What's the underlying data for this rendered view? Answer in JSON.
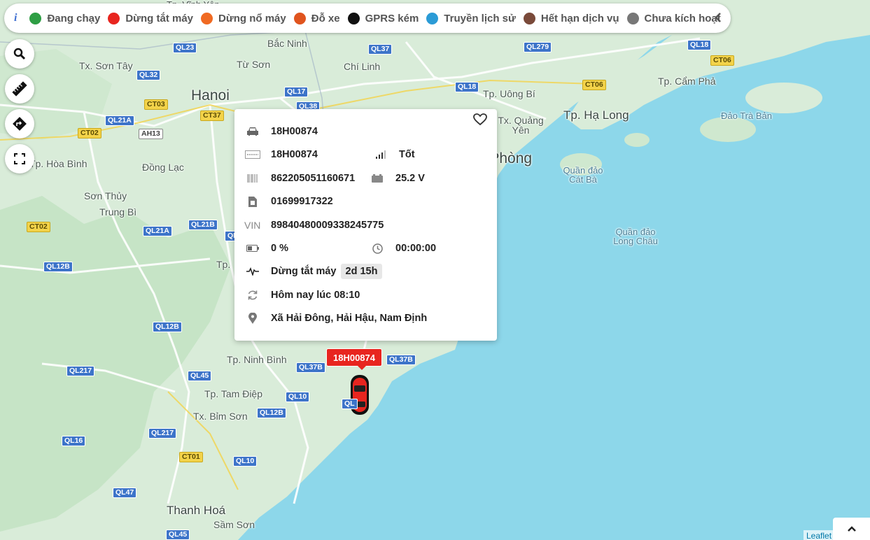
{
  "legend": {
    "info_icon": "i",
    "items": [
      {
        "label": "Đang chạy",
        "color": "#2e9e44"
      },
      {
        "label": "Dừng tắt máy",
        "color": "#e8251f"
      },
      {
        "label": "Dừng nổ máy",
        "color": "#f06a22"
      },
      {
        "label": "Đỗ xe",
        "color": "#e0541e"
      },
      {
        "label": "GPRS kém",
        "color": "#111111"
      },
      {
        "label": "Truyền lịch sử",
        "color": "#2b9bd6"
      },
      {
        "label": "Hết hạn dịch vụ",
        "color": "#7a4a3a"
      },
      {
        "label": "Chưa kích hoạt",
        "color": "#777777"
      }
    ],
    "collapse_icon": "chevron-left-icon"
  },
  "controls": [
    "search-icon",
    "ruler-icon",
    "directions-icon",
    "fullscreen-icon"
  ],
  "popup": {
    "plate": "18H00874",
    "license_plate": "18H00874",
    "signal": "Tốt",
    "imei": "862205051160671",
    "voltage": "25.2 V",
    "sim": "01699917322",
    "vin_label": "VIN",
    "vin": "89840480009338245775",
    "battery": "0 %",
    "duration": "00:00:00",
    "status": "Dừng tắt máy",
    "status_duration": "2d 15h",
    "updated": "Hôm nay lúc 08:10",
    "address": "Xã Hải Đông, Hải Hậu, Nam Định"
  },
  "vehicle": {
    "label": "18H00874",
    "color": "#e8251f"
  },
  "map": {
    "places": {
      "vinh_yen": "Tp. Vĩnh Yên",
      "bac_ninh": "Bắc Ninh",
      "tx_son_tay": "Tx. Sơn Tây",
      "tu_son": "Từ Sơn",
      "chi_linh": "Chí Linh",
      "hanoi": "Hanoi",
      "uong_bi": "Tp. Uông Bí",
      "cam_pha": "Tp. Cẩm Phả",
      "ha_long": "Tp. Hạ Long",
      "tx_quang_yen": "Tx. Quảng Yên",
      "dao_tra_ban": "Đảo Trà Bản",
      "hoa_binh": "Tp. Hòa Bình",
      "dong_lac": "Đồng Lạc",
      "hai_phong": "Hải Phòng",
      "quan_dao_cat_ba": "Quần đảo Cát Bà",
      "son_thuy": "Sơn Thủy",
      "trung_bi": "Trung Bì",
      "quan_dao_long_chau": "Quần đảo Long Châu",
      "tp_partial": "Tp.",
      "ninh_binh": "Tp. Ninh Bình",
      "tam_diep": "Tp. Tam Điệp",
      "bim_son": "Tx. Bỉm Sơn",
      "thanh_hoa": "Thanh Hoá",
      "sam_son": "Sầm Sơn"
    },
    "roads": {
      "ql23": "QL23",
      "ql37a": "QL37",
      "ql279": "QL279",
      "ql18a": "QL18",
      "ct06a": "CT06",
      "ql32": "QL32",
      "ql17": "QL17",
      "ql18b": "QL18",
      "ct06b": "CT06",
      "ct03": "CT03",
      "ct37": "CT37",
      "ql38": "QL38",
      "ql21a": "QL21A",
      "ah13": "AH13",
      "ct02a": "CT02",
      "ql21b": "QL21B",
      "ql21a2": "QL21A",
      "ct02b": "CT02",
      "ql12b": "QL12B",
      "ql12b2": "QL12B",
      "ql217": "QL217",
      "ql45": "QL45",
      "ql37b": "QL37B",
      "ql37b2": "QL37B",
      "ql10": "QL10",
      "ql12b3": "QL12B",
      "ql2172": "QL217",
      "ql16": "QL16",
      "ct01": "CT01",
      "ql102": "QL10",
      "ql47": "QL47",
      "ql452": "QL45",
      "ql_partial": "QL",
      "ql_top": "QL2"
    },
    "attribution": "Leaflet"
  },
  "scroll_top_icon": "chevron-up-icon"
}
